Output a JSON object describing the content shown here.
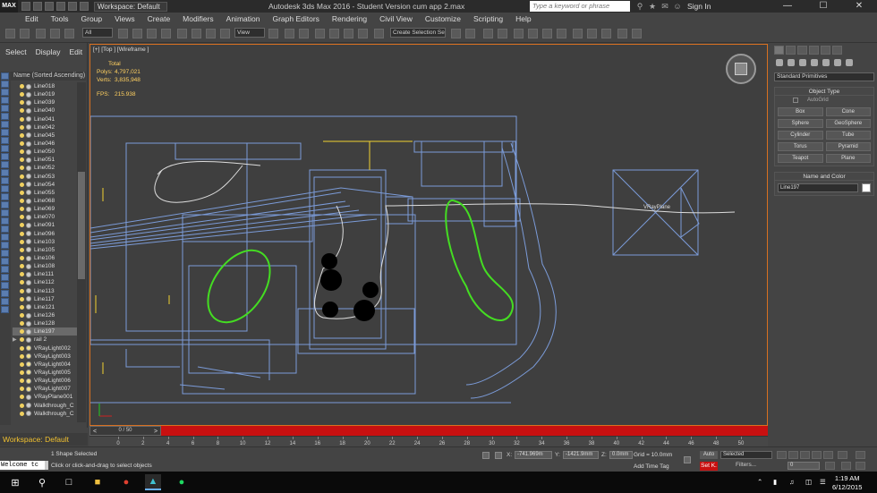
{
  "titlebar": {
    "logo": "MAX",
    "workspace": "Workspace: Default",
    "title": "Autodesk 3ds Max 2016 - Student Version    cum app 2.max",
    "search_placeholder": "Type a keyword or phrase",
    "signin": "Sign In",
    "minimize": "—",
    "maximize": "☐",
    "close": "✕"
  },
  "menu": [
    "Edit",
    "Tools",
    "Group",
    "Views",
    "Create",
    "Modifiers",
    "Animation",
    "Graph Editors",
    "Rendering",
    "Civil View",
    "Customize",
    "Scripting",
    "Help"
  ],
  "toolbar": {
    "filter": "All",
    "ref_coord": "View",
    "selection_set": "Create Selection Se"
  },
  "explorer": {
    "tabs": [
      "Select",
      "Display",
      "Edit"
    ],
    "column_header": "Name (Sorted Ascending)",
    "items": [
      {
        "name": "Line018",
        "kind": "geo"
      },
      {
        "name": "Line019",
        "kind": "geo"
      },
      {
        "name": "Line039",
        "kind": "geo"
      },
      {
        "name": "Line040",
        "kind": "geo"
      },
      {
        "name": "Line041",
        "kind": "geo"
      },
      {
        "name": "Line042",
        "kind": "geo"
      },
      {
        "name": "Line045",
        "kind": "geo"
      },
      {
        "name": "Line046",
        "kind": "geo"
      },
      {
        "name": "Line050",
        "kind": "geo"
      },
      {
        "name": "Line051",
        "kind": "geo"
      },
      {
        "name": "Line052",
        "kind": "geo"
      },
      {
        "name": "Line053",
        "kind": "geo"
      },
      {
        "name": "Line054",
        "kind": "geo"
      },
      {
        "name": "Line055",
        "kind": "geo"
      },
      {
        "name": "Line068",
        "kind": "geo"
      },
      {
        "name": "Line069",
        "kind": "geo"
      },
      {
        "name": "Line070",
        "kind": "geo"
      },
      {
        "name": "Line091",
        "kind": "geo"
      },
      {
        "name": "Line096",
        "kind": "geo"
      },
      {
        "name": "Line103",
        "kind": "geo"
      },
      {
        "name": "Line105",
        "kind": "geo"
      },
      {
        "name": "Line106",
        "kind": "geo"
      },
      {
        "name": "Line108",
        "kind": "geo"
      },
      {
        "name": "Line111",
        "kind": "geo"
      },
      {
        "name": "Line112",
        "kind": "geo"
      },
      {
        "name": "Line113",
        "kind": "geo"
      },
      {
        "name": "Line117",
        "kind": "geo"
      },
      {
        "name": "Line121",
        "kind": "geo"
      },
      {
        "name": "Line126",
        "kind": "geo"
      },
      {
        "name": "Line128",
        "kind": "geo"
      },
      {
        "name": "Line197",
        "kind": "geo",
        "selected": true
      },
      {
        "name": "rail 2",
        "kind": "group"
      },
      {
        "name": "VRayLight002",
        "kind": "light"
      },
      {
        "name": "VRayLight003",
        "kind": "light"
      },
      {
        "name": "VRayLight004",
        "kind": "light"
      },
      {
        "name": "VRayLight005",
        "kind": "light"
      },
      {
        "name": "VRayLight006",
        "kind": "light"
      },
      {
        "name": "VRayLight007",
        "kind": "light"
      },
      {
        "name": "VRayPlane001",
        "kind": "geo"
      },
      {
        "name": "Walkthrough_C",
        "kind": "geo"
      },
      {
        "name": "Walkthrough_C",
        "kind": "geo"
      }
    ],
    "workspace_label": "Workspace: Default"
  },
  "viewport": {
    "label": "[+] [Top ] [Wireframe ]",
    "stats": {
      "total_label": "Total",
      "polys_label": "Polys:",
      "polys": "4,797,021",
      "verts_label": "Verts:",
      "verts": "3,835,948",
      "fps_label": "FPS:",
      "fps": "215.938"
    },
    "plane_label": "VRayPlane"
  },
  "command_panel": {
    "category": "Standard Primitives",
    "object_type_title": "Object Type",
    "autogrid": "AutoGrid",
    "primitives": [
      "Box",
      "Cone",
      "Sphere",
      "GeoSphere",
      "Cylinder",
      "Tube",
      "Torus",
      "Pyramid",
      "Teapot",
      "Plane"
    ],
    "name_color_title": "Name and Color",
    "object_name": "Line197"
  },
  "timeline": {
    "frame_display": "0 / 50",
    "prev": "<",
    "next": ">",
    "ticks": [
      "0",
      "2",
      "4",
      "6",
      "8",
      "10",
      "12",
      "14",
      "16",
      "18",
      "20",
      "22",
      "24",
      "26",
      "28",
      "30",
      "32",
      "34",
      "36",
      "38",
      "40",
      "42",
      "44",
      "46",
      "48",
      "50"
    ]
  },
  "status": {
    "maxscript": "Welcome tc",
    "selected": "1 Shape Selected",
    "prompt": "Click or click-and-drag to select objects",
    "x_label": "X:",
    "x": "-741.969m",
    "y_label": "Y:",
    "y": "-1421.9mm",
    "z_label": "Z:",
    "z": "0.0mm",
    "grid": "Grid = 10.0mm",
    "add_time_tag": "Add Time Tag",
    "auto": "Auto",
    "setk": "Set K.",
    "key_filter": "Selected",
    "filters": "Filters...",
    "frame": "0"
  },
  "taskbar": {
    "time": "1:19 AM",
    "date": "6/12/2015"
  },
  "colors": {
    "viewport_border": "#d87020",
    "wire_blue": "#7b9bd8",
    "spline_green": "#44dd22",
    "helper_yellow": "#f0d030",
    "time_slider_red": "#c81010"
  }
}
